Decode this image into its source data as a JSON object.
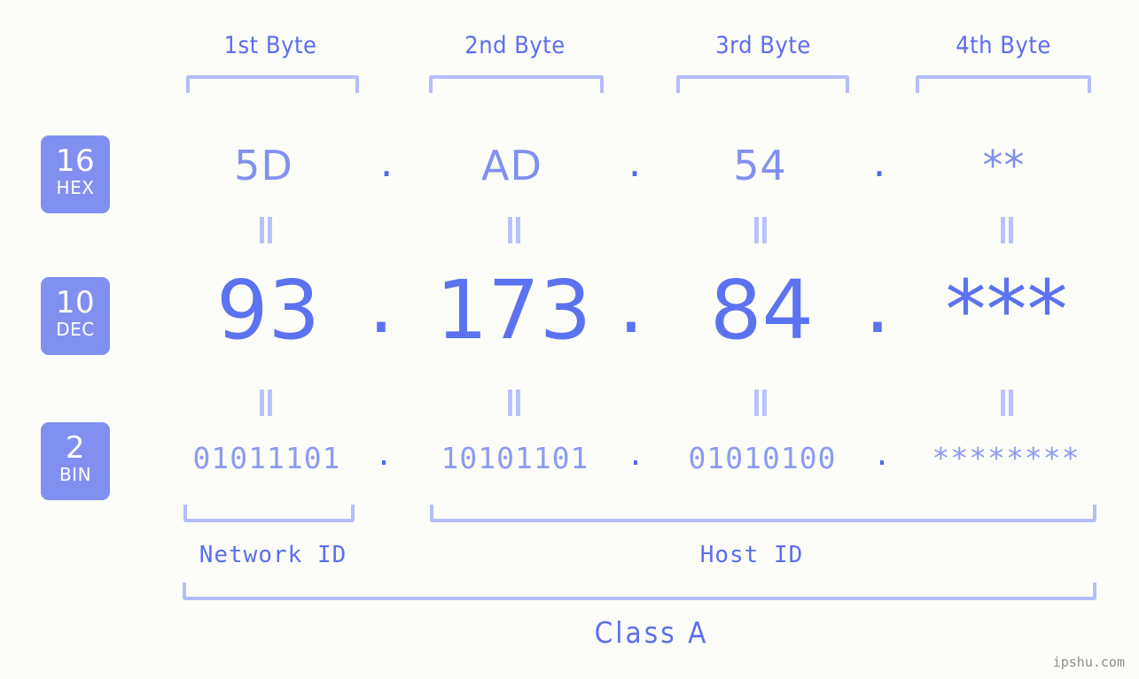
{
  "columns": [
    {
      "header": "1st Byte"
    },
    {
      "header": "2nd Byte"
    },
    {
      "header": "3rd Byte"
    },
    {
      "header": "4th Byte"
    }
  ],
  "rows": {
    "hex": {
      "badge_number": "16",
      "badge_name": "HEX",
      "values": [
        "5D",
        "AD",
        "54",
        "**"
      ],
      "separator": "."
    },
    "dec": {
      "badge_number": "10",
      "badge_name": "DEC",
      "values": [
        "93",
        "173",
        "84",
        "***"
      ],
      "separator": "."
    },
    "bin": {
      "badge_number": "2",
      "badge_name": "BIN",
      "values": [
        "01011101",
        "10101101",
        "01010100",
        "********"
      ],
      "separator": "."
    }
  },
  "equivalence_symbol": "=",
  "segments": {
    "network_id": "Network ID",
    "host_id": "Host ID",
    "class": "Class A"
  },
  "watermark": "ipshu.com",
  "colors": {
    "background": "#fcfdf8",
    "badge": "#8190f0",
    "badge_text": "#ffffff",
    "header_text": "#5b6ef0",
    "hex_text": "#8190f0",
    "dec_text": "#5b73f0",
    "bin_text": "#8c9bf2",
    "bracket": "#b5bdfb",
    "dot": "#4f68ef",
    "equals_mark": "#b9c2fb",
    "watermark_text": "#8d8d8d"
  }
}
